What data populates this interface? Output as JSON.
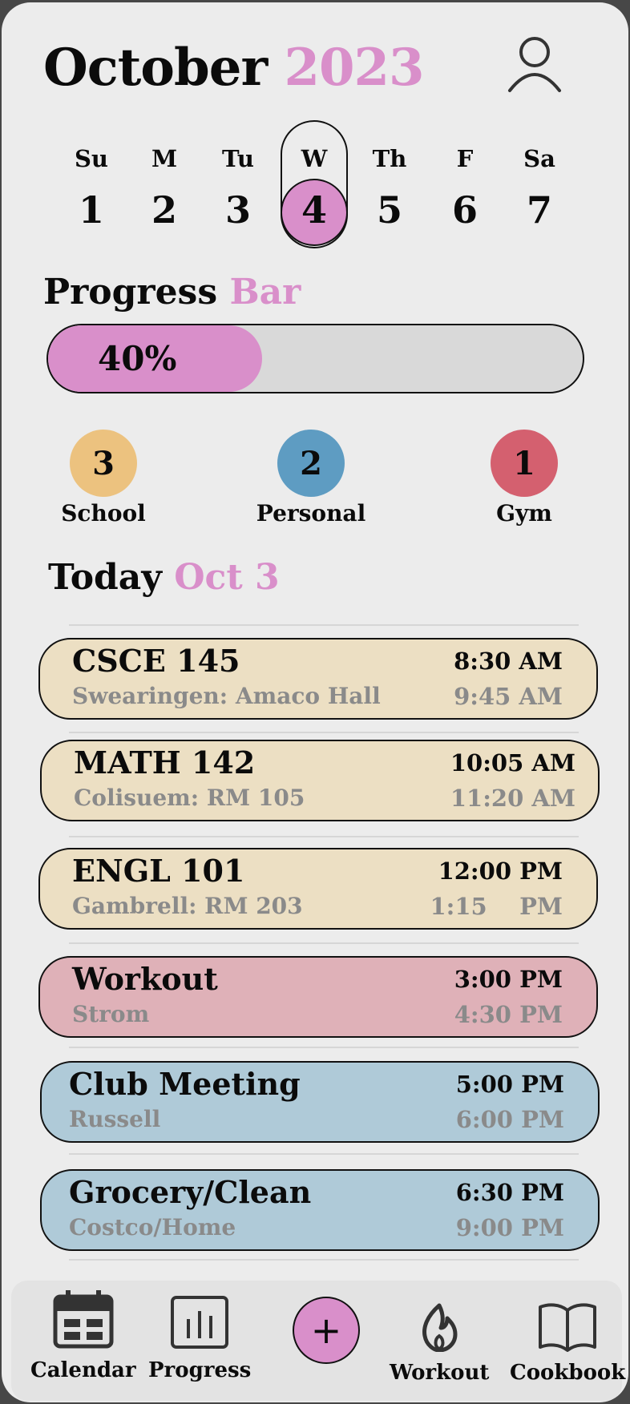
{
  "header": {
    "month": "October",
    "year": "2023"
  },
  "week": {
    "days": [
      {
        "label": "Su",
        "num": "1"
      },
      {
        "label": "M",
        "num": "2"
      },
      {
        "label": "Tu",
        "num": "3"
      },
      {
        "label": "W",
        "num": "4"
      },
      {
        "label": "Th",
        "num": "5"
      },
      {
        "label": "F",
        "num": "6"
      },
      {
        "label": "Sa",
        "num": "7"
      }
    ],
    "selected_index": 3
  },
  "progress": {
    "title": "Progress",
    "title_accent": "Bar",
    "percent_label": "40%",
    "fraction": 0.4
  },
  "categories": [
    {
      "count": "3",
      "label": "School",
      "color": "#ecc27f"
    },
    {
      "count": "2",
      "label": "Personal",
      "color": "#5e9cc2"
    },
    {
      "count": "1",
      "label": "Gym",
      "color": "#d4606f"
    }
  ],
  "today": {
    "title": "Today",
    "date": "Oct 3"
  },
  "events": [
    {
      "title": "CSCE 145",
      "location": "Swearingen: Amaco Hall",
      "start": "8:30 AM",
      "end": "9:45 AM",
      "color": "#ecdfc3"
    },
    {
      "title": "MATH 142",
      "location": "Colisuem: RM 105",
      "start": "10:05 AM",
      "end": "11:20 AM",
      "color": "#ecdfc3"
    },
    {
      "title": "ENGL 101",
      "location": "Gambrell: RM 203",
      "start": "12:00 PM",
      "end": "1:15    PM",
      "color": "#ecdfc3"
    },
    {
      "title": "Workout",
      "location": "Strom",
      "start": "3:00 PM",
      "end": "4:30 PM",
      "color": "#dfb1b8"
    },
    {
      "title": "Club Meeting",
      "location": "Russell",
      "start": "5:00 PM",
      "end": "6:00 PM",
      "color": "#afcad8"
    },
    {
      "title": "Grocery/Clean",
      "location": "Costco/Home",
      "start": "6:30 PM",
      "end": "9:00 PM",
      "color": "#afcad8"
    }
  ],
  "tabs": {
    "calendar": "Calendar",
    "progress": "Progress",
    "add": "+",
    "workout": "Workout",
    "cookbook": "Cookbook"
  },
  "icons": {
    "avatar": "user-icon",
    "calendar": "calendar-icon",
    "progress": "bar-chart-icon",
    "add": "plus-icon",
    "workout": "flame-icon",
    "cookbook": "book-icon"
  }
}
